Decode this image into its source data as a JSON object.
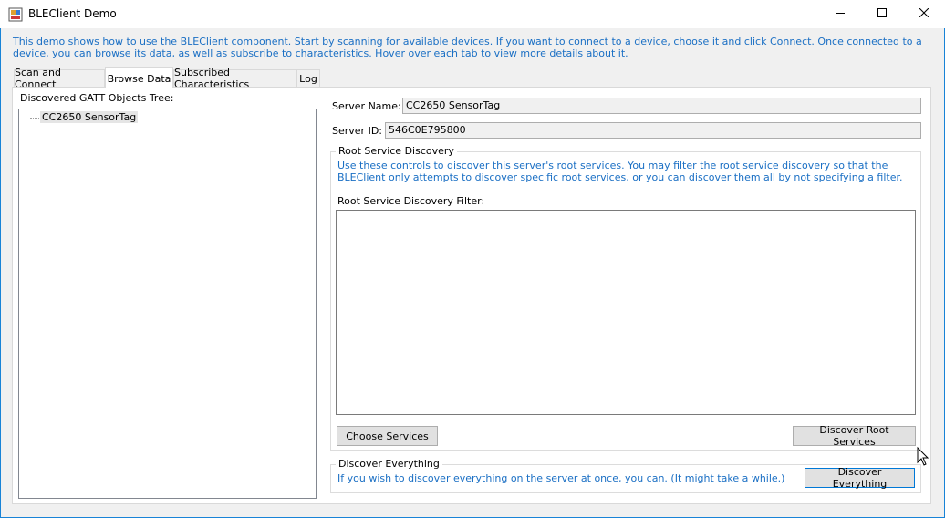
{
  "window": {
    "title": "BLEClient Demo",
    "icons": {
      "app": "app-icon",
      "minimize": "minimize-icon",
      "maximize": "maximize-icon",
      "close": "close-icon"
    }
  },
  "intro_text": "This demo shows how to use the BLEClient component. Start by scanning for available devices. If you want to connect to a device, choose it and click Connect. Once connected to a device, you can browse its data, as well as subscribe to characteristics. Hover over each tab to view more details about it.",
  "tabs": [
    {
      "label": "Scan and Connect",
      "active": false
    },
    {
      "label": "Browse Data",
      "active": true
    },
    {
      "label": "Subscribed Characteristics",
      "active": false
    },
    {
      "label": "Log",
      "active": false
    }
  ],
  "tree": {
    "label": "Discovered GATT Objects Tree:",
    "nodes": [
      {
        "label": "CC2650 SensorTag"
      }
    ]
  },
  "server": {
    "name_label": "Server Name:",
    "name_value": "CC2650 SensorTag",
    "id_label": "Server ID:",
    "id_value": "546C0E795800"
  },
  "root_discovery": {
    "title": "Root Service Discovery",
    "description": "Use these controls to discover this server's root services. You may filter the root service discovery so that the BLEClient only attempts to discover specific root services, or you can discover them all by not specifying a filter.",
    "filter_label": "Root Service Discovery Filter:",
    "filter_value": "",
    "choose_button": "Choose Services",
    "discover_button": "Discover Root Services"
  },
  "discover_everything": {
    "title": "Discover Everything",
    "description": "If you wish to discover everything on the server at once, you can. (It might take a while.)",
    "button": "Discover Everything"
  },
  "colors": {
    "accent": "#1a6fc4",
    "border": "#1883d7"
  }
}
